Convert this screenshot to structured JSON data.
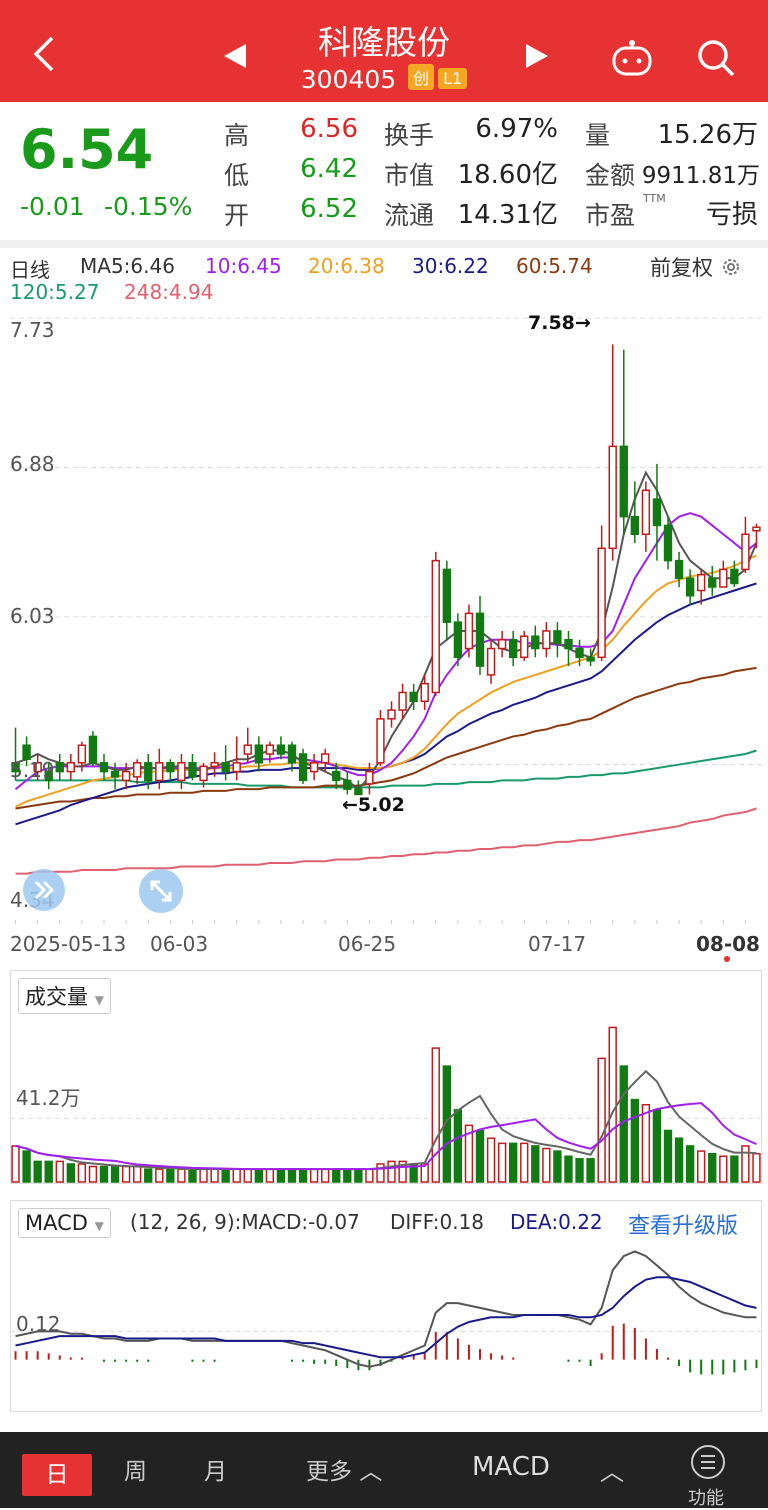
{
  "header": {
    "name": "科隆股份",
    "code": "300405",
    "tag1": "创",
    "tag2": "L1"
  },
  "quote": {
    "price": "6.54",
    "change": "-0.01",
    "change_pct": "-0.15%",
    "high_label": "高",
    "high": "6.56",
    "low_label": "低",
    "low": "6.42",
    "open_label": "开",
    "open": "6.52",
    "turnover_label": "换手",
    "turnover": "6.97%",
    "mktcap_label": "市值",
    "mktcap": "18.60亿",
    "float_label": "流通",
    "float": "14.31亿",
    "vol_label": "量",
    "vol": "15.26万",
    "amt_label": "金额",
    "amt": "9911.81万",
    "pe_label": "市盈",
    "pe_sup": "TTM",
    "pe": "亏损"
  },
  "colors": {
    "up": "#c21a1a",
    "down": "#127a12",
    "ma5": "#555555",
    "ma10": "#a020f0",
    "ma20": "#f0a020",
    "ma30": "#1a1a8a",
    "ma60": "#8b3a0f",
    "ma120": "#1a9a6a",
    "ma248": "#e06070"
  },
  "ma_legend": {
    "period": "日线",
    "ma5": "MA5:6.46",
    "ma10": "10:6.45",
    "ma20": "20:6.38",
    "ma30": "30:6.22",
    "ma60": "60:5.74",
    "ma120": "120:5.27",
    "ma248": "248:4.94",
    "adjust": "前复权"
  },
  "price_axis": {
    "ticks": [
      "7.73",
      "6.88",
      "6.03",
      "5.19",
      "4.34"
    ],
    "max_label": "7.58→",
    "min_label": "←5.02"
  },
  "dates": [
    "2025-05-13",
    "06-03",
    "06-25",
    "07-17",
    "08-08"
  ],
  "volume": {
    "selector": "成交量",
    "tick": "41.2万"
  },
  "macd": {
    "selector": "MACD",
    "info": "(12, 26, 9):MACD:-0.07",
    "diff": "DIFF:0.18",
    "dea": "DEA:0.22",
    "upgrade": "查看升级版",
    "tick": "0.12"
  },
  "tabs": {
    "day": "日",
    "week": "周",
    "month": "月",
    "more": "更多",
    "indicator": "MACD",
    "func": "功能"
  },
  "chart_data": {
    "type": "candlestick",
    "ylim": [
      4.34,
      7.73
    ],
    "max": 7.58,
    "min": 5.02,
    "x": [
      "2025-05-13",
      "06-03",
      "06-25",
      "07-17",
      "08-08"
    ],
    "candles": [
      [
        5.2,
        5.15,
        5.4,
        5.1
      ],
      [
        5.3,
        5.22,
        5.35,
        5.18
      ],
      [
        5.15,
        5.2,
        5.25,
        5.1
      ],
      [
        5.15,
        5.1,
        5.2,
        5.05
      ],
      [
        5.2,
        5.15,
        5.25,
        5.1
      ],
      [
        5.15,
        5.2,
        5.25,
        5.1
      ],
      [
        5.2,
        5.3,
        5.32,
        5.15
      ],
      [
        5.35,
        5.2,
        5.38,
        5.18
      ],
      [
        5.2,
        5.15,
        5.25,
        5.1
      ],
      [
        5.15,
        5.12,
        5.2,
        5.05
      ],
      [
        5.1,
        5.15,
        5.2,
        5.05
      ],
      [
        5.12,
        5.2,
        5.22,
        5.08
      ],
      [
        5.2,
        5.1,
        5.25,
        5.05
      ],
      [
        5.1,
        5.2,
        5.28,
        5.05
      ],
      [
        5.2,
        5.15,
        5.22,
        5.1
      ],
      [
        5.1,
        5.2,
        5.25,
        5.05
      ],
      [
        5.2,
        5.12,
        5.25,
        5.1
      ],
      [
        5.1,
        5.18,
        5.2,
        5.06
      ],
      [
        5.18,
        5.2,
        5.26,
        5.12
      ],
      [
        5.2,
        5.15,
        5.3,
        5.1
      ],
      [
        5.15,
        5.2,
        5.35,
        5.1
      ],
      [
        5.25,
        5.3,
        5.4,
        5.2
      ],
      [
        5.3,
        5.2,
        5.35,
        5.15
      ],
      [
        5.25,
        5.3,
        5.32,
        5.2
      ],
      [
        5.3,
        5.25,
        5.35,
        5.22
      ],
      [
        5.3,
        5.2,
        5.32,
        5.15
      ],
      [
        5.25,
        5.1,
        5.28,
        5.08
      ],
      [
        5.15,
        5.2,
        5.25,
        5.1
      ],
      [
        5.2,
        5.25,
        5.28,
        5.15
      ],
      [
        5.15,
        5.1,
        5.2,
        5.05
      ],
      [
        5.1,
        5.05,
        5.15,
        5.02
      ],
      [
        5.05,
        5.02,
        5.1,
        5.02
      ],
      [
        5.08,
        5.15,
        5.2,
        5.02
      ],
      [
        5.2,
        5.45,
        5.5,
        5.18
      ],
      [
        5.45,
        5.5,
        5.55,
        5.4
      ],
      [
        5.5,
        5.6,
        5.65,
        5.45
      ],
      [
        5.6,
        5.55,
        5.65,
        5.5
      ],
      [
        5.55,
        5.65,
        5.7,
        5.5
      ],
      [
        5.6,
        6.35,
        6.4,
        5.58
      ],
      [
        6.3,
        6.0,
        6.35,
        5.9
      ],
      [
        6.0,
        5.8,
        6.05,
        5.75
      ],
      [
        5.85,
        6.05,
        6.1,
        5.8
      ],
      [
        6.05,
        5.75,
        6.15,
        5.7
      ],
      [
        5.7,
        5.85,
        5.9,
        5.65
      ],
      [
        5.85,
        5.9,
        5.95,
        5.8
      ],
      [
        5.9,
        5.8,
        5.95,
        5.75
      ],
      [
        5.8,
        5.92,
        5.95,
        5.78
      ],
      [
        5.92,
        5.85,
        5.98,
        5.8
      ],
      [
        5.85,
        5.95,
        6.0,
        5.8
      ],
      [
        5.95,
        5.88,
        6.0,
        5.8
      ],
      [
        5.9,
        5.85,
        5.95,
        5.75
      ],
      [
        5.85,
        5.8,
        5.9,
        5.75
      ],
      [
        5.8,
        5.78,
        5.85,
        5.75
      ],
      [
        5.8,
        6.42,
        6.55,
        5.78
      ],
      [
        6.42,
        7.0,
        7.58,
        6.35
      ],
      [
        7.0,
        6.6,
        7.55,
        6.5
      ],
      [
        6.6,
        6.5,
        6.8,
        6.45
      ],
      [
        6.5,
        6.75,
        6.8,
        6.4
      ],
      [
        6.7,
        6.55,
        6.9,
        6.35
      ],
      [
        6.55,
        6.35,
        6.6,
        6.3
      ],
      [
        6.35,
        6.25,
        6.4,
        6.2
      ],
      [
        6.25,
        6.15,
        6.3,
        6.1
      ],
      [
        6.18,
        6.27,
        6.3,
        6.1
      ],
      [
        6.25,
        6.2,
        6.32,
        6.15
      ],
      [
        6.2,
        6.3,
        6.35,
        6.2
      ],
      [
        6.3,
        6.22,
        6.35,
        6.2
      ],
      [
        6.3,
        6.5,
        6.6,
        6.28
      ],
      [
        6.52,
        6.54,
        6.56,
        6.42
      ]
    ],
    "ma5": [
      5.2,
      5.22,
      5.25,
      5.22,
      5.2,
      5.18,
      5.18,
      5.2,
      5.18,
      5.16,
      5.16,
      5.18,
      5.17,
      5.17,
      5.18,
      5.18,
      5.16,
      5.16,
      5.18,
      5.2,
      5.22,
      5.22,
      5.25,
      5.27,
      5.27,
      5.25,
      5.2,
      5.18,
      5.15,
      5.12,
      5.1,
      5.05,
      5.12,
      5.22,
      5.35,
      5.45,
      5.55,
      5.7,
      5.85,
      5.9,
      5.95,
      5.95,
      5.95,
      5.9,
      5.85,
      5.83,
      5.85,
      5.88,
      5.88,
      5.88,
      5.85,
      5.82,
      5.8,
      5.95,
      6.2,
      6.5,
      6.7,
      6.85,
      6.75,
      6.6,
      6.45,
      6.35,
      6.3,
      6.25,
      6.25,
      6.25,
      6.3,
      6.45
    ],
    "ma10": [
      5.05,
      5.1,
      5.15,
      5.17,
      5.18,
      5.18,
      5.18,
      5.18,
      5.18,
      5.17,
      5.17,
      5.17,
      5.17,
      5.17,
      5.17,
      5.17,
      5.17,
      5.17,
      5.17,
      5.18,
      5.19,
      5.2,
      5.22,
      5.22,
      5.23,
      5.23,
      5.22,
      5.21,
      5.2,
      5.18,
      5.15,
      5.13,
      5.13,
      5.16,
      5.2,
      5.27,
      5.35,
      5.45,
      5.6,
      5.7,
      5.78,
      5.85,
      5.88,
      5.9,
      5.9,
      5.9,
      5.88,
      5.88,
      5.88,
      5.87,
      5.87,
      5.86,
      5.86,
      5.88,
      5.95,
      6.1,
      6.25,
      6.35,
      6.45,
      6.55,
      6.6,
      6.62,
      6.6,
      6.55,
      6.5,
      6.45,
      6.4,
      6.45
    ],
    "ma20": [
      4.95,
      4.98,
      5.0,
      5.02,
      5.04,
      5.06,
      5.08,
      5.1,
      5.11,
      5.12,
      5.13,
      5.14,
      5.15,
      5.15,
      5.16,
      5.16,
      5.16,
      5.16,
      5.17,
      5.17,
      5.17,
      5.18,
      5.18,
      5.19,
      5.19,
      5.2,
      5.2,
      5.2,
      5.2,
      5.19,
      5.18,
      5.17,
      5.17,
      5.17,
      5.18,
      5.2,
      5.23,
      5.28,
      5.35,
      5.42,
      5.48,
      5.52,
      5.56,
      5.6,
      5.63,
      5.66,
      5.68,
      5.7,
      5.72,
      5.74,
      5.76,
      5.78,
      5.8,
      5.84,
      5.9,
      5.98,
      6.05,
      6.12,
      6.18,
      6.22,
      6.24,
      6.26,
      6.27,
      6.28,
      6.3,
      6.32,
      6.35,
      6.38
    ],
    "ma30": [
      4.85,
      4.87,
      4.89,
      4.91,
      4.93,
      4.96,
      4.98,
      5.0,
      5.02,
      5.04,
      5.06,
      5.07,
      5.08,
      5.09,
      5.1,
      5.11,
      5.12,
      5.13,
      5.14,
      5.14,
      5.15,
      5.15,
      5.16,
      5.16,
      5.16,
      5.17,
      5.17,
      5.17,
      5.17,
      5.17,
      5.17,
      5.16,
      5.16,
      5.17,
      5.18,
      5.2,
      5.22,
      5.25,
      5.3,
      5.35,
      5.38,
      5.42,
      5.45,
      5.48,
      5.5,
      5.53,
      5.55,
      5.57,
      5.6,
      5.62,
      5.64,
      5.66,
      5.68,
      5.72,
      5.78,
      5.84,
      5.9,
      5.95,
      6.0,
      6.04,
      6.07,
      6.1,
      6.12,
      6.14,
      6.16,
      6.18,
      6.2,
      6.22
    ],
    "ma60": [
      4.94,
      4.95,
      4.96,
      4.97,
      4.98,
      4.98,
      4.99,
      5.0,
      5.0,
      5.01,
      5.01,
      5.02,
      5.02,
      5.02,
      5.03,
      5.03,
      5.03,
      5.04,
      5.04,
      5.04,
      5.05,
      5.05,
      5.05,
      5.06,
      5.06,
      5.06,
      5.06,
      5.06,
      5.07,
      5.07,
      5.07,
      5.07,
      5.08,
      5.09,
      5.1,
      5.12,
      5.14,
      5.17,
      5.2,
      5.23,
      5.25,
      5.27,
      5.29,
      5.31,
      5.33,
      5.35,
      5.36,
      5.38,
      5.39,
      5.41,
      5.42,
      5.44,
      5.45,
      5.48,
      5.51,
      5.54,
      5.57,
      5.59,
      5.61,
      5.63,
      5.65,
      5.66,
      5.68,
      5.69,
      5.7,
      5.72,
      5.73,
      5.74
    ],
    "ma120": [
      5.1,
      5.1,
      5.1,
      5.1,
      5.1,
      5.1,
      5.1,
      5.1,
      5.1,
      5.1,
      5.1,
      5.09,
      5.09,
      5.09,
      5.09,
      5.09,
      5.08,
      5.08,
      5.08,
      5.08,
      5.08,
      5.07,
      5.07,
      5.07,
      5.07,
      5.06,
      5.06,
      5.06,
      5.06,
      5.06,
      5.06,
      5.06,
      5.06,
      5.06,
      5.07,
      5.07,
      5.07,
      5.07,
      5.08,
      5.08,
      5.08,
      5.09,
      5.09,
      5.09,
      5.1,
      5.1,
      5.1,
      5.11,
      5.11,
      5.11,
      5.12,
      5.12,
      5.13,
      5.13,
      5.14,
      5.14,
      5.15,
      5.16,
      5.17,
      5.18,
      5.19,
      5.2,
      5.21,
      5.22,
      5.23,
      5.24,
      5.25,
      5.27
    ],
    "ma248": [
      4.57,
      4.57,
      4.58,
      4.58,
      4.58,
      4.58,
      4.59,
      4.59,
      4.59,
      4.59,
      4.6,
      4.6,
      4.6,
      4.6,
      4.6,
      4.61,
      4.61,
      4.61,
      4.61,
      4.62,
      4.62,
      4.62,
      4.62,
      4.63,
      4.63,
      4.63,
      4.64,
      4.64,
      4.64,
      4.65,
      4.65,
      4.65,
      4.66,
      4.66,
      4.67,
      4.67,
      4.68,
      4.68,
      4.69,
      4.69,
      4.7,
      4.7,
      4.71,
      4.71,
      4.72,
      4.72,
      4.73,
      4.73,
      4.74,
      4.75,
      4.75,
      4.76,
      4.76,
      4.77,
      4.78,
      4.79,
      4.8,
      4.81,
      4.82,
      4.83,
      4.84,
      4.86,
      4.87,
      4.88,
      4.9,
      4.91,
      4.92,
      4.94
    ],
    "volume": [
      14,
      12,
      8,
      8,
      8,
      7,
      7,
      6,
      6,
      6,
      6,
      6,
      5,
      5,
      5,
      5,
      5,
      5,
      5,
      5,
      5,
      5,
      5,
      5,
      5,
      5,
      5,
      5,
      5,
      5,
      5,
      5,
      5,
      7,
      8,
      8,
      7,
      7,
      52,
      45,
      28,
      22,
      20,
      17,
      15,
      15,
      15,
      14,
      13,
      12,
      10,
      9,
      9,
      48,
      60,
      45,
      32,
      30,
      28,
      20,
      17,
      14,
      12,
      11,
      10,
      10,
      14,
      11
    ],
    "vol_up": [
      1,
      0,
      0,
      0,
      1,
      0,
      1,
      1,
      0,
      0,
      1,
      1,
      0,
      1,
      0,
      1,
      0,
      1,
      1,
      0,
      1,
      1,
      0,
      1,
      0,
      0,
      0,
      1,
      1,
      0,
      0,
      0,
      1,
      1,
      1,
      1,
      0,
      1,
      1,
      0,
      0,
      1,
      0,
      1,
      1,
      0,
      1,
      0,
      1,
      0,
      0,
      0,
      0,
      1,
      1,
      0,
      0,
      1,
      0,
      0,
      0,
      0,
      1,
      0,
      1,
      0,
      1,
      1
    ],
    "diff": [
      0.1,
      0.11,
      0.12,
      0.12,
      0.12,
      0.11,
      0.11,
      0.1,
      0.09,
      0.09,
      0.08,
      0.08,
      0.08,
      0.09,
      0.09,
      0.09,
      0.08,
      0.08,
      0.08,
      0.08,
      0.08,
      0.08,
      0.08,
      0.08,
      0.08,
      0.07,
      0.06,
      0.05,
      0.04,
      0.02,
      0.0,
      -0.02,
      -0.03,
      -0.02,
      0.0,
      0.02,
      0.04,
      0.06,
      0.2,
      0.24,
      0.24,
      0.23,
      0.22,
      0.21,
      0.2,
      0.19,
      0.19,
      0.19,
      0.19,
      0.19,
      0.18,
      0.17,
      0.15,
      0.22,
      0.38,
      0.44,
      0.46,
      0.44,
      0.4,
      0.36,
      0.31,
      0.27,
      0.24,
      0.22,
      0.2,
      0.19,
      0.18,
      0.18
    ],
    "dea": [
      0.06,
      0.07,
      0.08,
      0.09,
      0.1,
      0.1,
      0.1,
      0.1,
      0.1,
      0.1,
      0.09,
      0.09,
      0.09,
      0.09,
      0.09,
      0.09,
      0.09,
      0.09,
      0.09,
      0.08,
      0.08,
      0.08,
      0.08,
      0.08,
      0.08,
      0.08,
      0.07,
      0.07,
      0.06,
      0.05,
      0.04,
      0.03,
      0.02,
      0.01,
      0.01,
      0.01,
      0.02,
      0.03,
      0.07,
      0.11,
      0.14,
      0.16,
      0.17,
      0.18,
      0.18,
      0.18,
      0.19,
      0.19,
      0.19,
      0.19,
      0.19,
      0.18,
      0.18,
      0.19,
      0.22,
      0.27,
      0.31,
      0.34,
      0.35,
      0.35,
      0.34,
      0.33,
      0.31,
      0.29,
      0.27,
      0.25,
      0.23,
      0.22
    ]
  }
}
